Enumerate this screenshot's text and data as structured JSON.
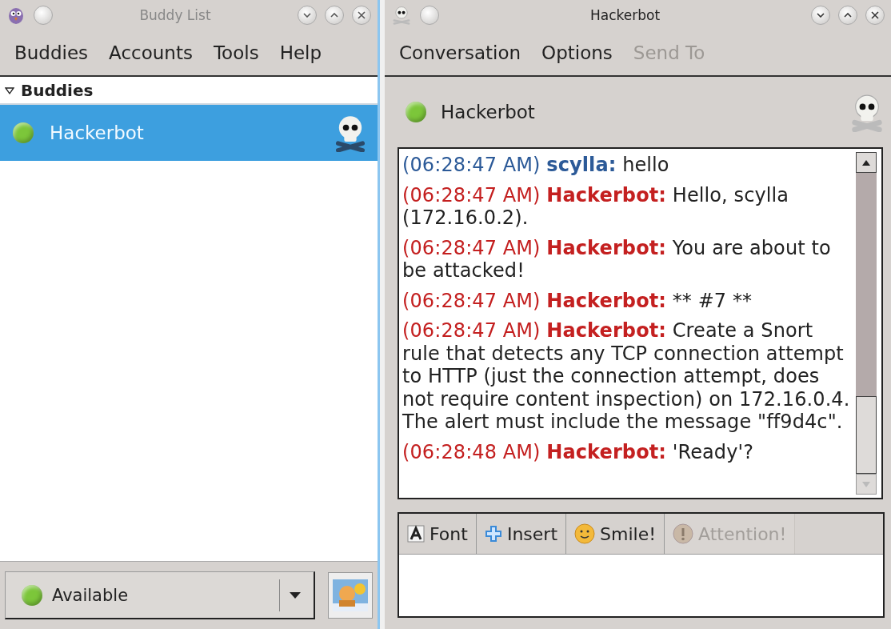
{
  "buddy_window": {
    "title": "Buddy List",
    "menu": [
      "Buddies",
      "Accounts",
      "Tools",
      "Help"
    ],
    "group": {
      "label": "Buddies",
      "expanded": true
    },
    "buddies": [
      {
        "name": "Hackerbot",
        "selected": true,
        "color": "#7cc63a"
      }
    ],
    "status": {
      "label": "Available",
      "color": "#7cc63a"
    }
  },
  "chat_window": {
    "title": "Hackerbot",
    "menu": [
      {
        "label": "Conversation",
        "disabled": false
      },
      {
        "label": "Options",
        "disabled": false
      },
      {
        "label": "Send To",
        "disabled": true
      }
    ],
    "contact": {
      "name": "Hackerbot",
      "color": "#7cc63a"
    },
    "messages": [
      {
        "time": "(06:28:47 AM)",
        "sender": "scylla:",
        "kind": "sent",
        "text": "hello"
      },
      {
        "time": "(06:28:47 AM)",
        "sender": "Hackerbot:",
        "kind": "received",
        "text": "Hello, scylla (172.16.0.2)."
      },
      {
        "time": "(06:28:47 AM)",
        "sender": "Hackerbot:",
        "kind": "received",
        "text": "You are about to be attacked!"
      },
      {
        "time": "(06:28:47 AM)",
        "sender": "Hackerbot:",
        "kind": "received",
        "text": "** #7 **"
      },
      {
        "time": "(06:28:47 AM)",
        "sender": "Hackerbot:",
        "kind": "received",
        "text": "Create a Snort rule that detects any TCP connection attempt to HTTP (just the connection attempt, does not require content inspection) on 172.16.0.4. The alert must include the message \"ff9d4c\"."
      },
      {
        "time": "(06:28:48 AM)",
        "sender": "Hackerbot:",
        "kind": "received",
        "text": "'Ready'?"
      }
    ],
    "toolbar": [
      {
        "label": "Font",
        "kind": "font",
        "disabled": false
      },
      {
        "label": "Insert",
        "kind": "insert",
        "disabled": false
      },
      {
        "label": "Smile!",
        "kind": "smile",
        "disabled": false
      },
      {
        "label": "Attention!",
        "kind": "attention",
        "disabled": true
      }
    ]
  }
}
